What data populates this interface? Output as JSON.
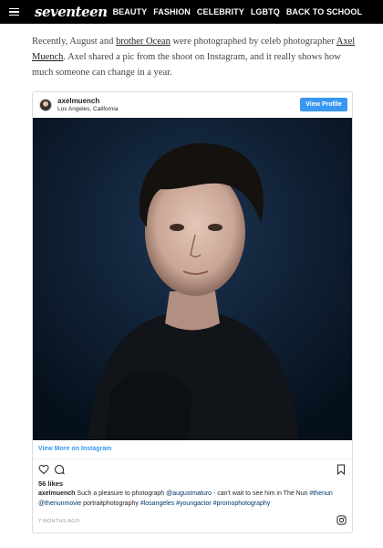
{
  "nav": {
    "logo": "seventeen",
    "items": [
      "BEAUTY",
      "FASHION",
      "CELEBRITY",
      "LGBTQ",
      "BACK TO SCHOOL"
    ]
  },
  "article": {
    "p1_a": "Recently, August and ",
    "p1_link1": "brother Ocean",
    "p1_b": " were photographed by celeb photographer ",
    "p1_link2": "Axel Muench",
    "p1_c": ". Axel shared a pic from the shoot on Instagram, and it really shows how much someone can change in a year."
  },
  "embed": {
    "username": "axelmuench",
    "location": "Los Angeles, California",
    "view_profile": "View Profile",
    "view_more": "View More on Instagram",
    "likes": "56 likes",
    "caption_user": "axelmuench",
    "caption_text": " Such a pleasure to photograph ",
    "mention1": "@augustmaturo",
    "caption_mid": " - can't wait to see him in The Nun ",
    "tag1": "#thenun",
    "mention2": "@thenunmovie",
    "caption_plain": " portraitphotography ",
    "tag2": "#losangeles",
    "tag3": "#youngactor",
    "tag4": "#promophotography",
    "timestamp": "7 MONTHS AGO"
  },
  "colors": {
    "nav_bg": "#000000",
    "ig_blue": "#3897f0",
    "photo_bg": "#0b1a2c"
  },
  "icons": [
    "menu-icon",
    "heart-icon",
    "comment-icon",
    "bookmark-icon",
    "instagram-icon"
  ]
}
